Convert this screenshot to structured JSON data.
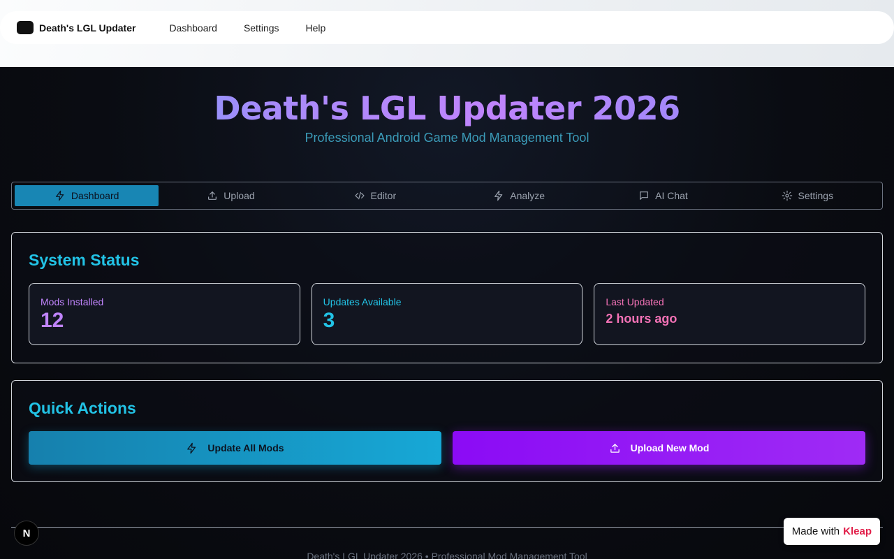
{
  "navbar": {
    "brand": "Death's LGL Updater",
    "links": [
      "Dashboard",
      "Settings",
      "Help"
    ]
  },
  "hero": {
    "title": "Death's LGL Updater 2026",
    "subtitle": "Professional Android Game Mod Management Tool"
  },
  "tabs": [
    {
      "label": "Dashboard",
      "icon": "lightning-icon",
      "active": true
    },
    {
      "label": "Upload",
      "icon": "upload-icon"
    },
    {
      "label": "Editor",
      "icon": "code-icon"
    },
    {
      "label": "Analyze",
      "icon": "lightning-icon"
    },
    {
      "label": "AI Chat",
      "icon": "chat-icon"
    },
    {
      "label": "Settings",
      "icon": "gear-icon"
    }
  ],
  "system_status": {
    "title": "System Status",
    "stats": [
      {
        "label": "Mods Installed",
        "value": "12",
        "color": "#c084fc"
      },
      {
        "label": "Updates Available",
        "value": "3",
        "color": "#22c3e6"
      },
      {
        "label": "Last Updated",
        "value": "2 hours ago",
        "color": "#f472b6"
      }
    ]
  },
  "quick_actions": {
    "title": "Quick Actions",
    "update_label": "Update All Mods",
    "upload_label": "Upload New Mod"
  },
  "footer": {
    "text": "Death's LGL Updater 2026 • Professional Mod Management Tool"
  },
  "badge": {
    "letter": "N"
  },
  "kleap": {
    "prefix": "Made with",
    "brand": "Kleap"
  },
  "colors": {
    "accent_cyan": "#22c3e6",
    "accent_purple": "#8b0bf5",
    "active_tab": "#1886b4"
  }
}
